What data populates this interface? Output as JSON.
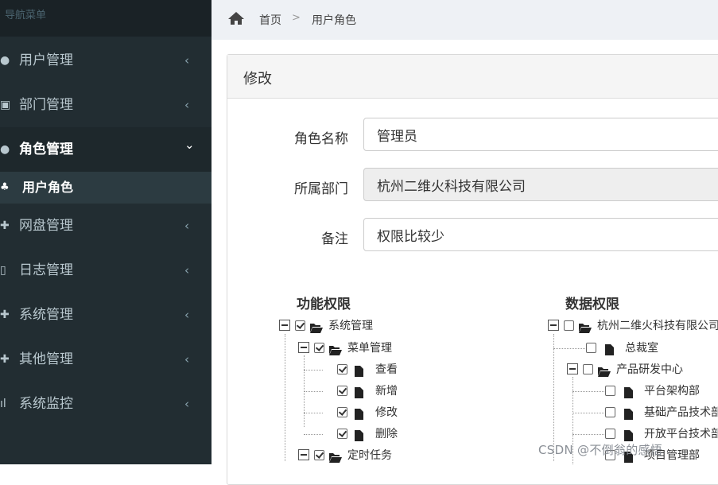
{
  "sidebar": {
    "header": "导航菜单",
    "items": [
      {
        "label": "用户管理",
        "icon": "user-icon",
        "arrow": "‹"
      },
      {
        "label": "部门管理",
        "icon": "building-icon",
        "arrow": "‹"
      },
      {
        "label": "角色管理",
        "icon": "role-icon",
        "arrow": "⌄"
      },
      {
        "label": "网盘管理",
        "icon": "cloud-icon",
        "arrow": "‹"
      },
      {
        "label": "日志管理",
        "icon": "log-icon",
        "arrow": "‹"
      },
      {
        "label": "系统管理",
        "icon": "settings-icon",
        "arrow": "‹"
      },
      {
        "label": "其他管理",
        "icon": "other-icon",
        "arrow": "‹"
      },
      {
        "label": "系统监控",
        "icon": "monitor-icon",
        "arrow": "‹"
      }
    ],
    "sub_item": {
      "label": "用户角色",
      "icon": "user-role-icon"
    }
  },
  "breadcrumb": {
    "home": "首页",
    "separator": ">",
    "current": "用户角色"
  },
  "panel": {
    "title": "修改"
  },
  "form": {
    "role_name_label": "角色名称",
    "role_name_value": "管理员",
    "dept_label": "所属部门",
    "dept_value": "杭州二维火科技有限公司",
    "remark_label": "备注",
    "remark_value": "权限比较少"
  },
  "func_perm": {
    "title": "功能权限",
    "nodes": [
      {
        "label": "系统管理",
        "checked": true
      },
      {
        "label": "菜单管理",
        "checked": true
      },
      {
        "label": "查看",
        "checked": true
      },
      {
        "label": "新增",
        "checked": true
      },
      {
        "label": "修改",
        "checked": true
      },
      {
        "label": "删除",
        "checked": true
      },
      {
        "label": "定时任务",
        "checked": true
      }
    ]
  },
  "data_perm": {
    "title": "数据权限",
    "nodes": [
      {
        "label": "杭州二维火科技有限公司",
        "checked": false
      },
      {
        "label": "总裁室",
        "checked": false
      },
      {
        "label": "产品研发中心",
        "checked": false
      },
      {
        "label": "平台架构部",
        "checked": false
      },
      {
        "label": "基础产品技术部",
        "checked": false
      },
      {
        "label": "开放平台技术部",
        "checked": false
      },
      {
        "label": "项目管理部",
        "checked": false
      }
    ]
  },
  "watermark": "CSDN @不倒翁的感悟"
}
